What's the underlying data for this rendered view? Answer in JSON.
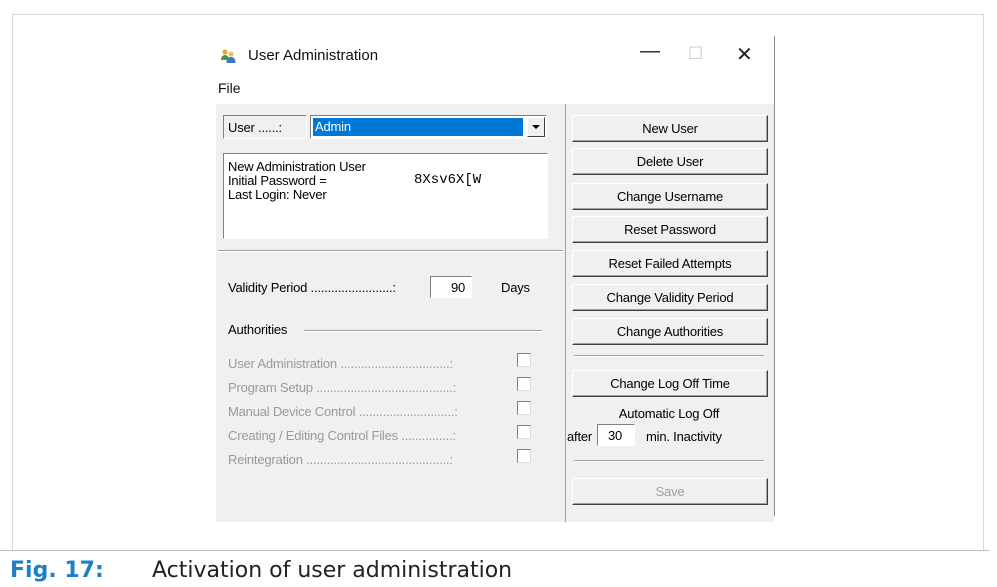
{
  "window": {
    "title": "User Administration",
    "menu": [
      "File"
    ],
    "controls": {
      "minimize": "—",
      "maximize": "☐",
      "close": "✕"
    }
  },
  "user_select": {
    "label": "User ......:",
    "value": "Admin"
  },
  "info_box": {
    "line1": "New Administration User",
    "line2_label": "Initial Password =",
    "line2_value": "8Xsv6X[W",
    "line3": "Last Login: Never"
  },
  "validity": {
    "label": "Validity Period ........................:",
    "value": "90",
    "unit": "Days"
  },
  "authorities": {
    "title": "Authorities",
    "items": [
      {
        "label": "User Administration ................................:",
        "checked": false
      },
      {
        "label": "Program Setup ........................................:",
        "checked": false
      },
      {
        "label": "Manual Device Control ............................:",
        "checked": false
      },
      {
        "label": "Creating / Editing Control Files ...............:",
        "checked": false
      },
      {
        "label": "Reintegration ..........................................:",
        "checked": false
      }
    ]
  },
  "buttons": {
    "new_user": "New User",
    "delete_user": "Delete User",
    "change_username": "Change Username",
    "reset_password": "Reset Password",
    "reset_failed": "Reset Failed Attempts",
    "change_validity": "Change Validity Period",
    "change_authorities": "Change Authorities",
    "change_logoff": "Change Log Off Time",
    "save": "Save"
  },
  "logoff": {
    "title": "Automatic Log Off",
    "prefix": "after",
    "value": "30",
    "suffix": "min. Inactivity"
  },
  "caption": {
    "number": "Fig. 17:",
    "text": "Activation of user administration"
  },
  "colors": {
    "selection": "#0078d7",
    "caption_accent": "#1f7fc4",
    "dialog_face": "#f0f0f0"
  }
}
